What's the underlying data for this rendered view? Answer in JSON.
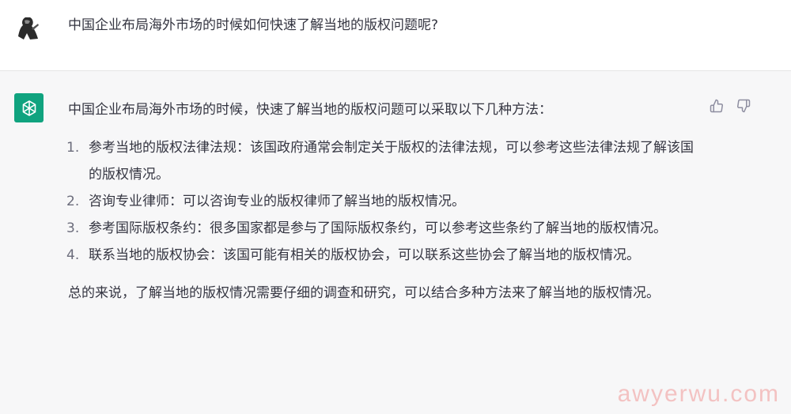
{
  "user": {
    "avatar_icon": "user-avatar-icon",
    "message": "中国企业布局海外市场的时候如何快速了解当地的版权问题呢?"
  },
  "assistant": {
    "avatar_icon": "openai-logo-icon",
    "avatar_color": "#10a37f",
    "intro": "中国企业布局海外市场的时候，快速了解当地的版权问题可以采取以下几种方法：",
    "methods": [
      {
        "number": "1.",
        "text": "参考当地的版权法律法规：该国政府通常会制定关于版权的法律法规，可以参考这些法律法规了解该国的版权情况。"
      },
      {
        "number": "2.",
        "text": "咨询专业律师：可以咨询专业的版权律师了解当地的版权情况。"
      },
      {
        "number": "3.",
        "text": "参考国际版权条约：很多国家都是参与了国际版权条约，可以参考这些条约了解当地的版权情况。"
      },
      {
        "number": "4.",
        "text": "联系当地的版权协会：该国可能有相关的版权协会，可以联系这些协会了解当地的版权情况。"
      }
    ],
    "summary": "总的来说，了解当地的版权情况需要仔细的调查和研究，可以结合多种方法来了解当地的版权情况。",
    "feedback": {
      "thumbs_up_icon": "thumbs-up-icon",
      "thumbs_down_icon": "thumbs-down-icon"
    }
  },
  "watermark": "awyerwu.com"
}
